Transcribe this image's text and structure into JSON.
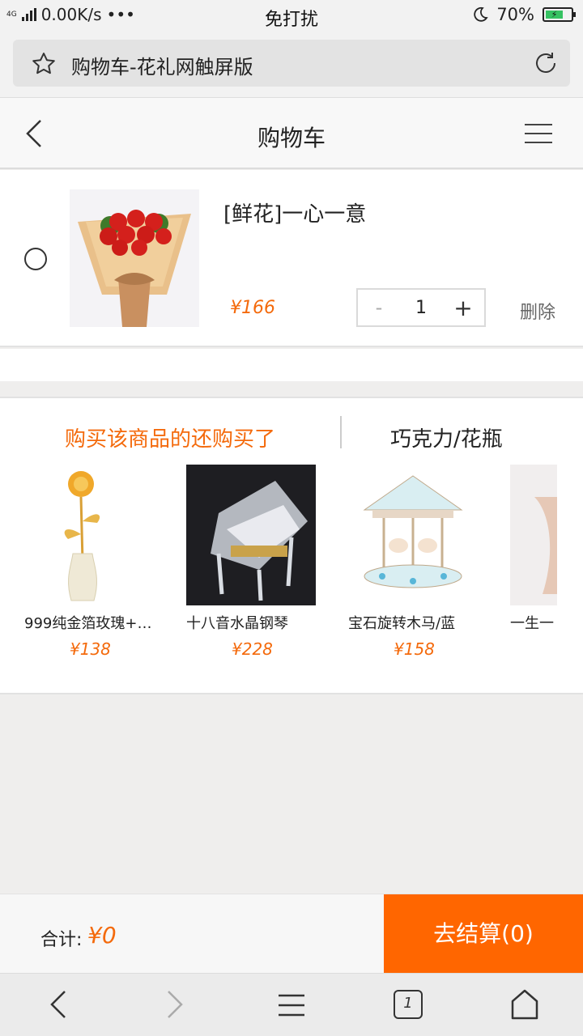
{
  "status_bar": {
    "network": "4G",
    "speed": "0.00K/s",
    "dots": "•••",
    "mode": "免打扰",
    "battery": "70%"
  },
  "url_bar": {
    "title": "购物车-花礼网触屏版"
  },
  "header": {
    "title": "购物车"
  },
  "cart": {
    "items": [
      {
        "name": "[鲜花]一心一意",
        "price": "¥166",
        "quantity": "1",
        "minus": "-",
        "plus": "+",
        "delete_label": "删除"
      }
    ]
  },
  "recommend": {
    "tab_active": "购买该商品的还购买了",
    "tab_other": "巧克力/花瓶",
    "products": [
      {
        "name": "999纯金箔玫瑰+…",
        "price": "¥138"
      },
      {
        "name": "十八音水晶钢琴",
        "price": "¥228"
      },
      {
        "name": "宝石旋转木马/蓝",
        "price": "¥158"
      },
      {
        "name": "一生一",
        "price": ""
      }
    ]
  },
  "checkout": {
    "total_label": "合计:",
    "total_amount": "¥0",
    "button_label": "去结算(0)"
  },
  "browser_nav": {
    "tabs_count": "1"
  },
  "colors": {
    "accent": "#ff6600",
    "price": "#f46a0c"
  }
}
